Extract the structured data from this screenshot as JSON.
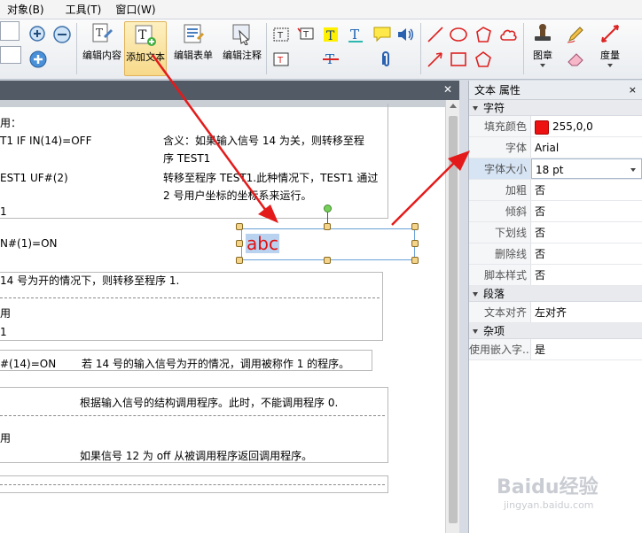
{
  "menu": {
    "items": [
      "对象(B)",
      "工具(T)",
      "窗口(W)"
    ]
  },
  "ribbon": {
    "buttons": {
      "edit_content": "编辑内容",
      "add_text": "添加文本",
      "edit_form": "编辑表单",
      "edit_annotation": "编辑注释",
      "stamp": "图章",
      "measure": "度量"
    }
  },
  "document": {
    "lines": {
      "l1": "用：",
      "l2": "T1 IF IN(14)=OFF",
      "l3": "含义：如果输入信号 14 为关，则转移至程",
      "l4": "序 TEST1",
      "l5": "EST1 UF#(2)",
      "l6": "转移至程序 TEST1.此种情况下，TEST1 通过",
      "l7": "2 号用户坐标的坐标系来运行。",
      "l8": "1",
      "l9": "N#(1)=ON",
      "l10": "14 号为开的情况下，则转移至程序 1.",
      "l11": "用",
      "l12": "1",
      "l13": "#(14)=ON",
      "l14": "若 14 号的输入信号为开的情况，调用被称作 1 的程序。",
      "l15": "根据输入信号的结构调用程序。此时，不能调用程序 0.",
      "l16": "用",
      "l17": "如果信号 12 为 off 从被调用程序返回调用程序。"
    },
    "textbox_value": "abc"
  },
  "properties": {
    "title": "文本 属性",
    "close": "×",
    "cat_char": "字符",
    "fill_color_label": "填充颜色",
    "fill_color_value": "255,0,0",
    "font_label": "字体",
    "font_value": "Arial",
    "font_size_label": "字体大小",
    "font_size_value": "18 pt",
    "bold_label": "加粗",
    "bold_value": "否",
    "italic_label": "倾斜",
    "italic_value": "否",
    "underline_label": "下划线",
    "underline_value": "否",
    "strike_label": "删除线",
    "strike_value": "否",
    "script_label": "脚本样式",
    "script_value": "否",
    "cat_para": "段落",
    "align_label": "文本对齐",
    "align_value": "左对齐",
    "cat_misc": "杂项",
    "embed_label": "使用嵌入字...",
    "embed_value": "是"
  },
  "watermark": {
    "brand": "Baidu经验",
    "url": "jingyan.baidu.com"
  },
  "colors": {
    "fill": "#ff0000",
    "arrow": "#e41a1a",
    "text_red": "#e01010"
  }
}
